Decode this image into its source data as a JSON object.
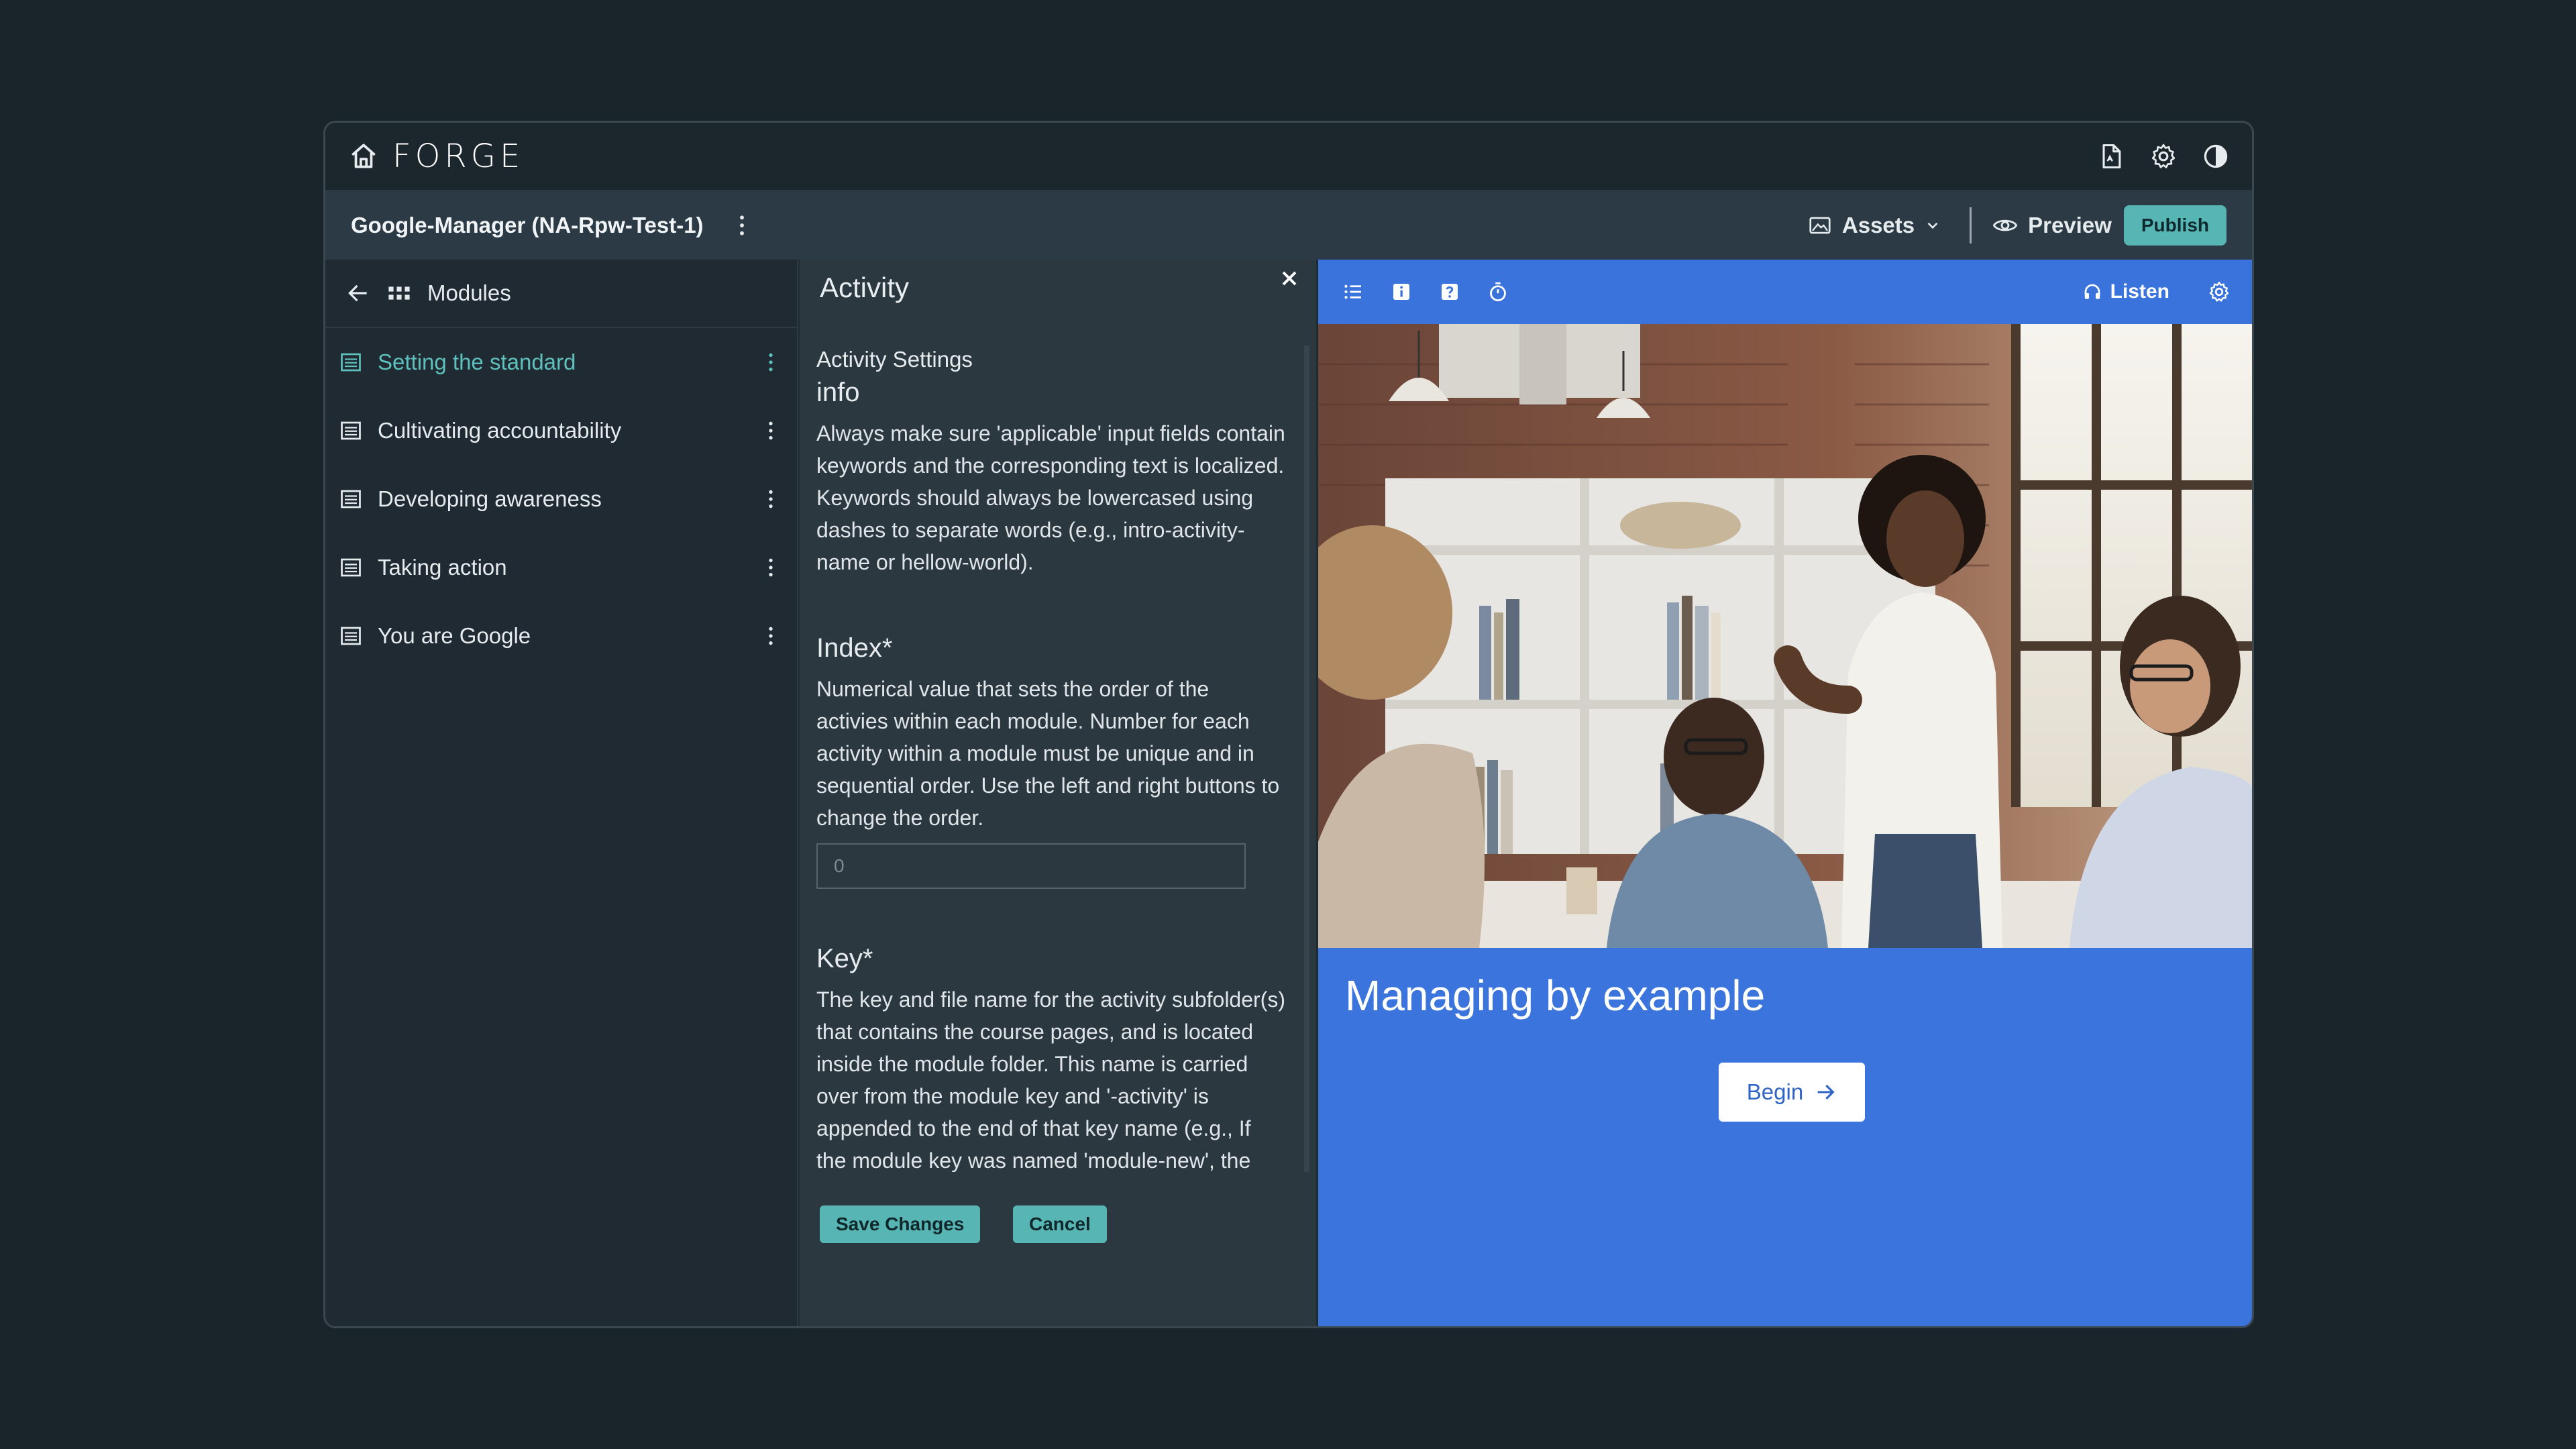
{
  "app": {
    "logo_text": "FORGE",
    "icons": [
      "home-icon",
      "file-pdf-icon",
      "gear-icon",
      "contrast-icon"
    ]
  },
  "project": {
    "title": "Google-Manager (NA-Rpw-Test-1)",
    "assets_label": "Assets",
    "preview_label": "Preview",
    "publish_label": "Publish"
  },
  "modules": {
    "title": "Modules",
    "items": [
      {
        "label": "Setting the standard",
        "active": true
      },
      {
        "label": "Cultivating accountability",
        "active": false
      },
      {
        "label": "Developing awareness",
        "active": false
      },
      {
        "label": "Taking action",
        "active": false
      },
      {
        "label": "You are Google",
        "active": false
      }
    ]
  },
  "activity": {
    "title": "Activity",
    "settings_label": "Activity Settings",
    "info_title": "info",
    "info_text": "Always make sure 'applicable' input fields contain keywords and the corresponding text is localized. Keywords should always be lowercased using dashes to separate words (e.g., intro-activity-name or hellow-world).",
    "index_title": "Index*",
    "index_text": "Numerical value that sets the order of the activies within each module. Number for each activity within a module must be unique and in sequential order. Use the left and right buttons to change the order.",
    "index_value": "0",
    "key_title": "Key*",
    "key_text": "The key and file name for the activity subfolder(s) that contains the course pages, and is located inside the module folder. This name is carried over from the module key and '-activity' is appended to the end of that key name (e.g., If the module key was named 'module-new', the activity key and folder will",
    "save_label": "Save Changes",
    "cancel_label": "Cancel"
  },
  "preview": {
    "listen_label": "Listen",
    "toolbar_icons": [
      "list-icon",
      "info-icon",
      "help-icon",
      "timer-icon"
    ],
    "hero_title": "Managing by example",
    "begin_label": "Begin",
    "accent_color": "#3b74dc"
  }
}
